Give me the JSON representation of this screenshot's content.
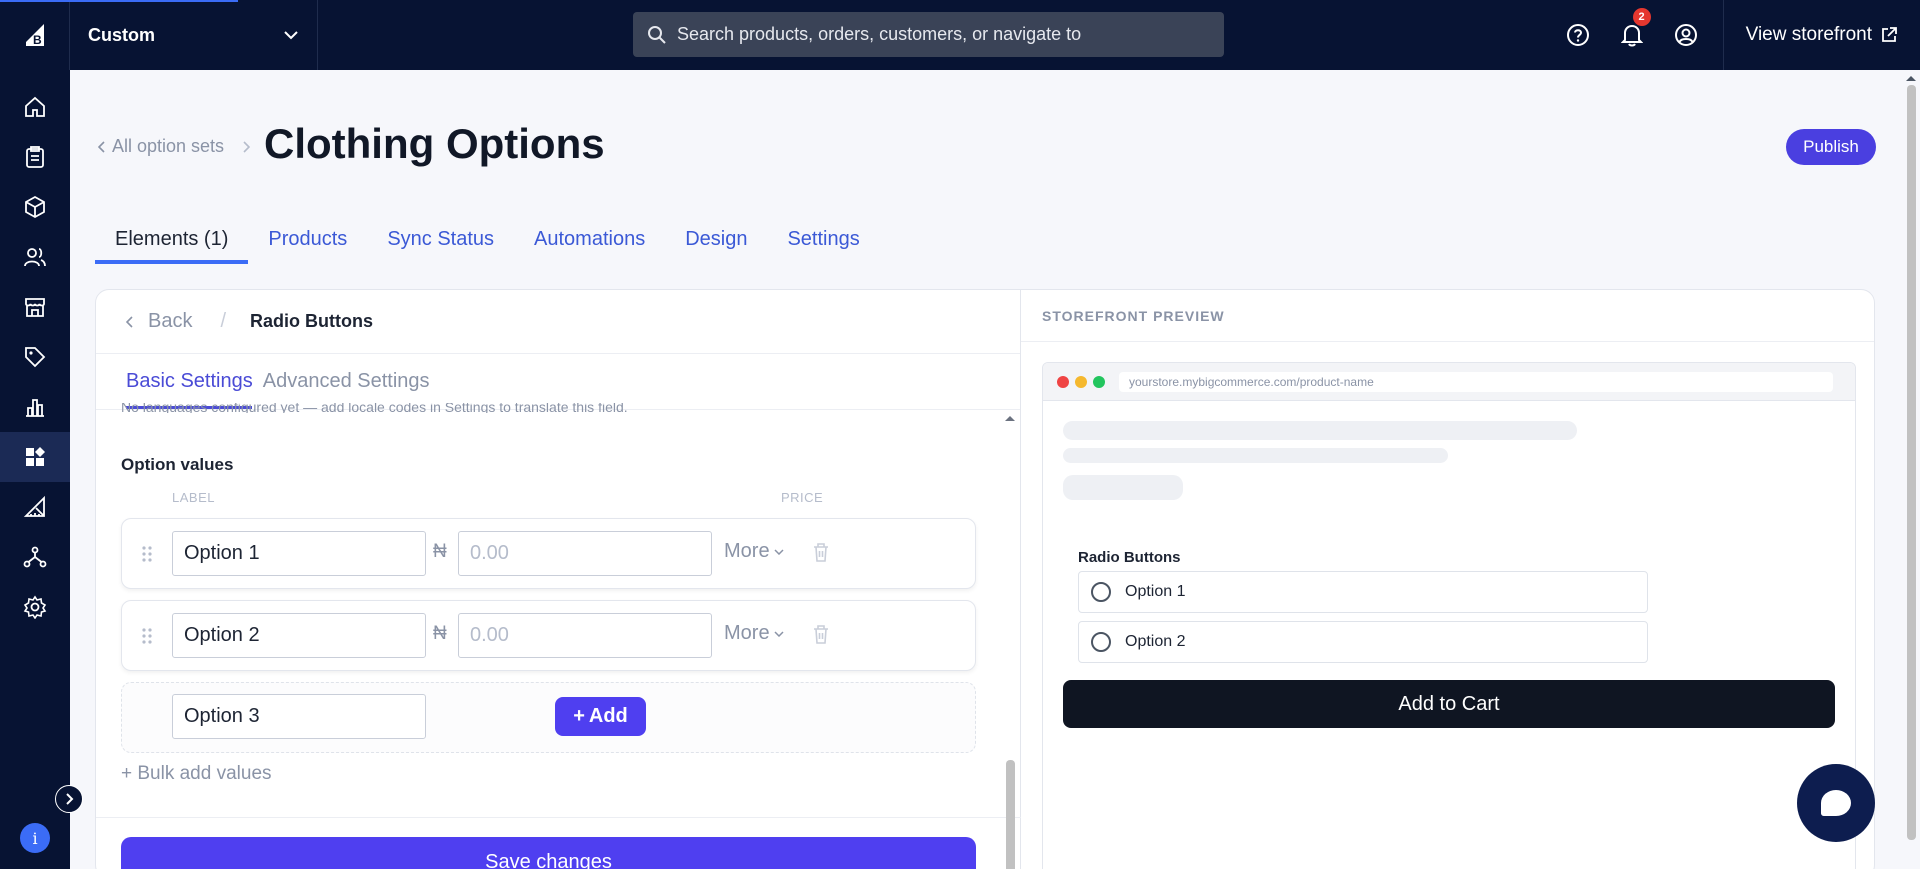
{
  "topbar": {
    "store_name": "Custom",
    "search_placeholder": "Search products, orders, customers, or navigate to",
    "notification_count": "2",
    "view_storefront": "View storefront"
  },
  "breadcrumb": {
    "back_label": "All option sets"
  },
  "page": {
    "title": "Clothing Options",
    "publish": "Publish"
  },
  "tabs": [
    "Elements (1)",
    "Products",
    "Sync Status",
    "Automations",
    "Design",
    "Settings"
  ],
  "editor": {
    "back": "Back",
    "element_name": "Radio Buttons",
    "subtabs": [
      "Basic Settings",
      "Advanced Settings"
    ],
    "notice": "No languages configured yet — add locale codes in Settings to translate this field.",
    "option_values_title": "Option values",
    "col_label": "LABEL",
    "col_price": "PRICE",
    "currency": "₦",
    "price_placeholder": "0.00",
    "more": "More",
    "options": [
      {
        "label": "Option 1"
      },
      {
        "label": "Option 2"
      }
    ],
    "new_option_value": "Option 3",
    "add_button": "Add",
    "bulk_add": "+ Bulk add values",
    "save": "Save changes"
  },
  "preview": {
    "title": "STOREFRONT PREVIEW",
    "url": "yourstore.mybigcommerce.com/product-name",
    "field_label": "Radio Buttons",
    "options": [
      "Option 1",
      "Option 2"
    ],
    "cart_button": "Add to Cart"
  },
  "colors": {
    "accent": "#4f3ff0",
    "nav_bg": "#071333",
    "link": "#3b59d6"
  }
}
